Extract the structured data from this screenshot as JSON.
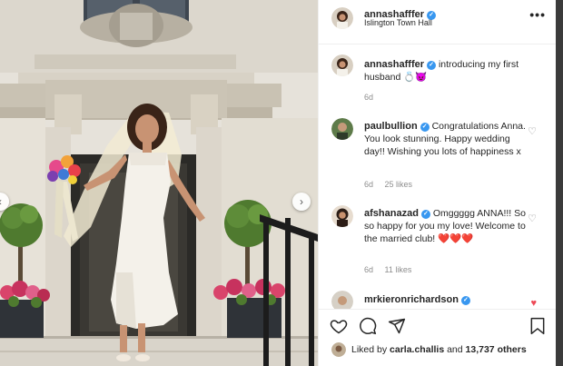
{
  "post": {
    "author": "annashafffer",
    "location": "Islington Town Hall",
    "caption": "introducing my first husband 💍😈",
    "caption_age": "6d"
  },
  "comments": [
    {
      "username": "paulbullion",
      "text": "Congratulations Anna. You look stunning. Happy wedding day!! Wishing you lots of happiness x",
      "age": "6d",
      "likes": "25 likes"
    },
    {
      "username": "afshanazad",
      "text": "Omggggg ANNA!!! So so happy for you my love! Welcome to the married club! ❤️❤️❤️",
      "age": "6d",
      "likes": "11 likes"
    },
    {
      "username": "mrkieronrichardson"
    }
  ],
  "likes_summary": {
    "prefix": "Liked by",
    "user": "carla.challis",
    "conjunction": "and",
    "count": "13,737 others"
  },
  "icons": {
    "more": "more-options-icon",
    "like": "heart-icon",
    "comment": "comment-icon",
    "share": "share-icon",
    "save": "bookmark-icon",
    "verified": "verified-badge-icon",
    "next": "chevron-right-icon",
    "prev": "chevron-left-icon"
  },
  "colors": {
    "verified": "#3897f0",
    "liked_heart": "#ed4956",
    "muted": "#8e8e8e"
  }
}
